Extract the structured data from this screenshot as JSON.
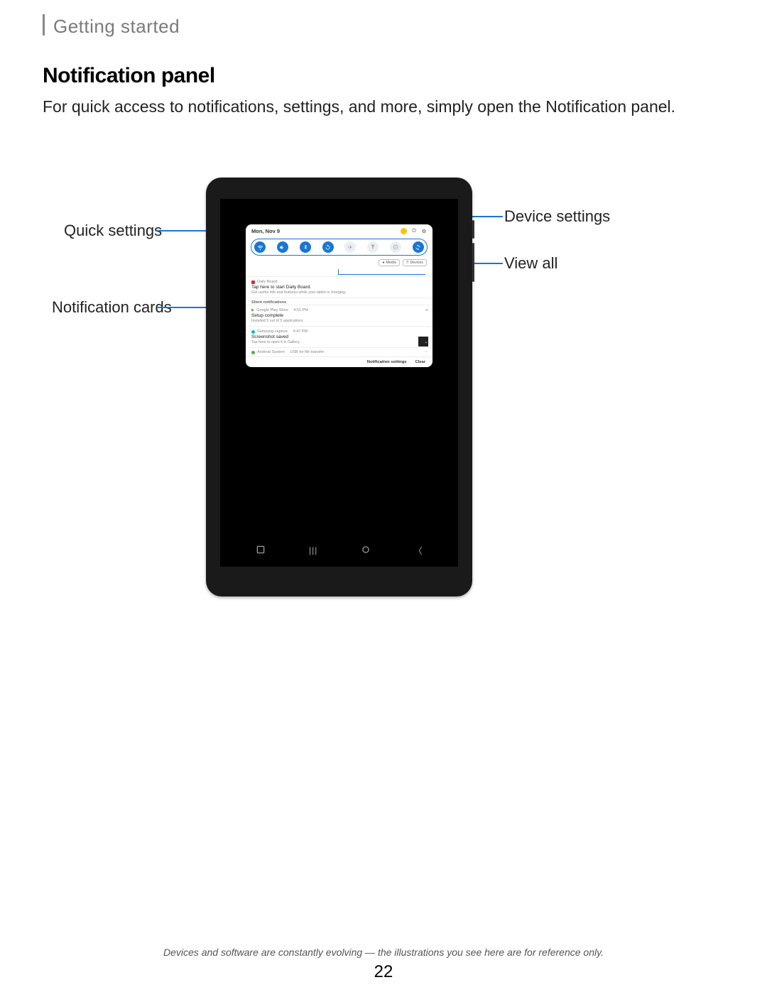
{
  "header": {
    "section": "Getting started"
  },
  "title": "Notification panel",
  "body": "For quick access to notifications, settings, and more, simply open the Notification panel.",
  "callouts": {
    "quick_settings": "Quick settings",
    "notification_cards": "Notification cards",
    "device_settings": "Device settings",
    "view_all": "View all"
  },
  "panel": {
    "date": "Mon, Nov 9",
    "media_btn": "Media",
    "devices_btn": "Devices",
    "silent_header": "Silent notifications",
    "cards": {
      "daily": {
        "app": "Daily Board",
        "title": "Tap here to start Daily Board.",
        "sub": "Get useful info and features while your tablet is charging."
      },
      "play": {
        "app": "Google Play Store",
        "time": "4:51 PM",
        "title": "Setup complete",
        "sub": "Installed 5 out of 5 applications"
      },
      "capture": {
        "app": "Samsung capture",
        "time": "4:47 PM",
        "title": "Screenshot saved",
        "sub": "Tap here to open it in Gallery."
      },
      "system": {
        "app": "Android System",
        "title": "USB for file transfer"
      }
    },
    "footer": {
      "settings": "Notification settings",
      "clear": "Clear"
    }
  },
  "footer_note": "Devices and software are constantly evolving — the illustrations you see here are for reference only.",
  "page_number": "22"
}
